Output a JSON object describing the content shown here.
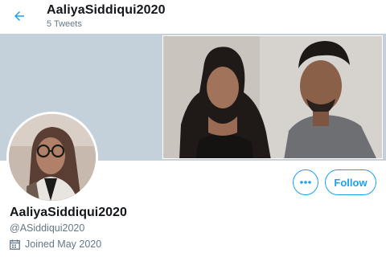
{
  "header": {
    "title": "AaliyaSiddiqui2020",
    "tweet_count": "5 Tweets",
    "back_icon": "arrow-left-icon"
  },
  "profile": {
    "display_name": "AaliyaSiddiqui2020",
    "handle": "@ASiddiqui2020",
    "joined": "Joined May 2020",
    "joined_icon": "calendar-icon"
  },
  "actions": {
    "more_icon": "more-options-icon",
    "follow_label": "Follow"
  },
  "colors": {
    "accent": "#1da1f2",
    "banner_bg": "#c5d1da",
    "secondary_text": "#657786",
    "primary_text": "#14171a"
  }
}
